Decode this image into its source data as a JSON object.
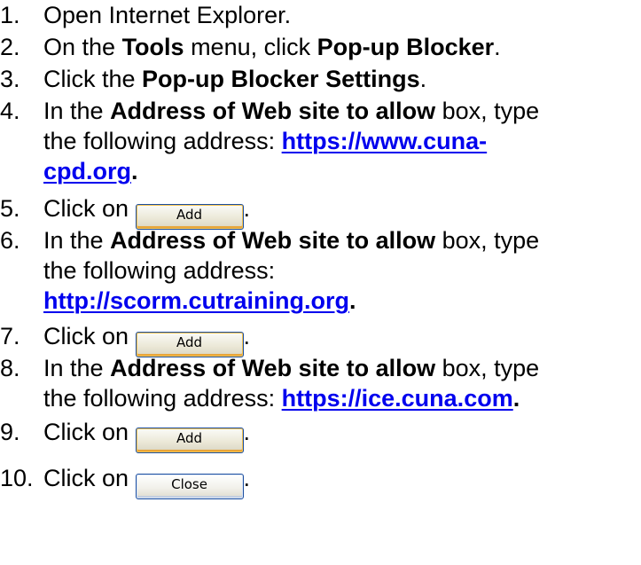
{
  "steps": [
    {
      "num": "1.",
      "lines": [
        [
          {
            "t": "Open Internet Explorer."
          }
        ]
      ]
    },
    {
      "num": "2.",
      "lines": [
        [
          {
            "t": "On the "
          },
          {
            "t": "Tools",
            "b": true
          },
          {
            "t": " menu, click "
          },
          {
            "t": "Pop-up Blocker",
            "b": true
          },
          {
            "t": "."
          }
        ]
      ]
    },
    {
      "num": "3.",
      "lines": [
        [
          {
            "t": "Click the "
          },
          {
            "t": "Pop-up Blocker Settings",
            "b": true
          },
          {
            "t": "."
          }
        ]
      ]
    },
    {
      "num": "4.",
      "lines": [
        [
          {
            "t": "In the "
          },
          {
            "t": "Address of Web site to allow",
            "b": true
          },
          {
            "t": " box, type"
          }
        ],
        [
          {
            "t": "the following address: "
          },
          {
            "t": "https://www.cuna-",
            "link": true
          }
        ],
        [
          {
            "t": "cpd.org",
            "link": true
          },
          {
            "t": ".",
            "b": true
          }
        ]
      ]
    },
    {
      "num": "5.",
      "lines": [
        [
          {
            "t": "Click on "
          },
          {
            "btn": "add",
            "label": "Add"
          },
          {
            "t": "."
          }
        ]
      ]
    },
    {
      "num": "6.",
      "lines": [
        [
          {
            "t": "In the "
          },
          {
            "t": "Address of Web site to allow",
            "b": true
          },
          {
            "t": " box, type"
          }
        ],
        [
          {
            "t": "the following address:"
          }
        ],
        [
          {
            "t": "http://scorm.cutraining.org",
            "link": true
          },
          {
            "t": ".",
            "b": true
          }
        ]
      ]
    },
    {
      "num": "7.",
      "lines": [
        [
          {
            "t": "Click on "
          },
          {
            "btn": "add",
            "label": "Add"
          },
          {
            "t": "."
          }
        ]
      ]
    },
    {
      "num": "8.",
      "lines": [
        [
          {
            "t": "In the "
          },
          {
            "t": "Address of Web site to allow",
            "b": true
          },
          {
            "t": " box, type"
          }
        ],
        [
          {
            "t": "the following address: "
          },
          {
            "t": "https://ice.cuna.com",
            "link": true
          },
          {
            "t": ".",
            "b": true
          }
        ]
      ]
    },
    {
      "num": "9.",
      "lines": [
        [
          {
            "t": "Click on "
          },
          {
            "btn": "add",
            "label": "Add"
          },
          {
            "t": "."
          }
        ]
      ]
    },
    {
      "num": "10.",
      "lines": [
        [
          {
            "t": "Click on "
          },
          {
            "btn": "close",
            "label": "Close"
          },
          {
            "t": "."
          }
        ]
      ]
    }
  ]
}
